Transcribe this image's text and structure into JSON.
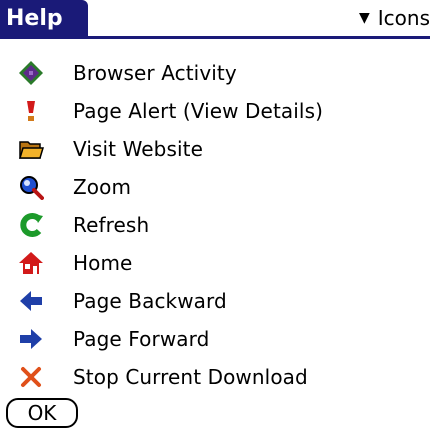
{
  "title": "Help",
  "category_picker": {
    "value": "Icons",
    "arrow_icon": "triangle-down-icon"
  },
  "items": [
    {
      "label": "Browser Activity",
      "icon": "browser-activity-icon",
      "color": "#2a7a2a"
    },
    {
      "label": "Page Alert (View Details)",
      "icon": "page-alert-icon",
      "color": "#d21a1a"
    },
    {
      "label": "Visit Website",
      "icon": "folder-icon",
      "color": "#e9a020"
    },
    {
      "label": "Zoom",
      "icon": "magnifier-icon",
      "color": "#1f4fd0"
    },
    {
      "label": "Refresh",
      "icon": "refresh-icon",
      "color": "#1c9a2a"
    },
    {
      "label": "Home",
      "icon": "home-icon",
      "color": "#d21a1a"
    },
    {
      "label": "Page Backward",
      "icon": "arrow-left-icon",
      "color": "#1f3fa8"
    },
    {
      "label": "Page Forward",
      "icon": "arrow-right-icon",
      "color": "#1f3fa8"
    },
    {
      "label": "Stop Current Download",
      "icon": "stop-icon",
      "color": "#e0501a"
    }
  ],
  "ok_label": "OK",
  "colors": {
    "title_bar": "#1a1a78",
    "background": "#ffffff"
  }
}
